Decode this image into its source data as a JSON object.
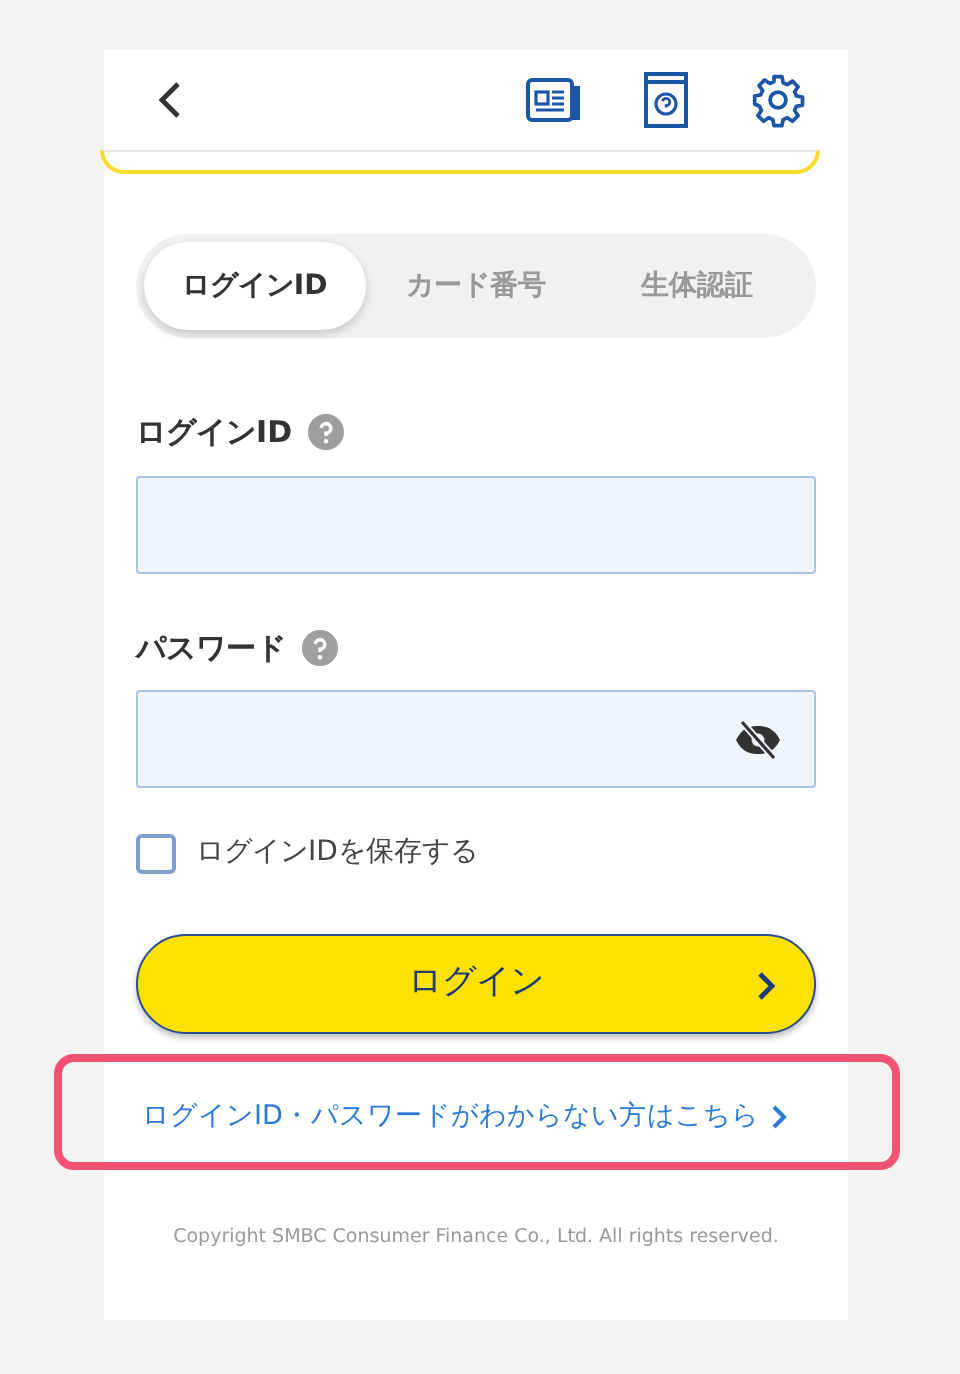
{
  "tabs": [
    {
      "label": "ログインID",
      "selected": true
    },
    {
      "label": "カード番号",
      "selected": false
    },
    {
      "label": "生体認証",
      "selected": false
    }
  ],
  "fields": [
    {
      "label": "ログインID",
      "kind": "text",
      "has_help": true
    },
    {
      "label": "パスワード",
      "kind": "password",
      "has_help": true,
      "masked": true
    }
  ],
  "save_login_id": {
    "label": "ログインIDを保存する",
    "checked": false
  },
  "login_button": {
    "label": "ログイン"
  },
  "help_link": {
    "label": "ログインID・パスワードがわからない方はこちら",
    "highlighted": true
  },
  "copyright": "Copyright SMBC Consumer Finance Co., Ltd. All rights reserved."
}
